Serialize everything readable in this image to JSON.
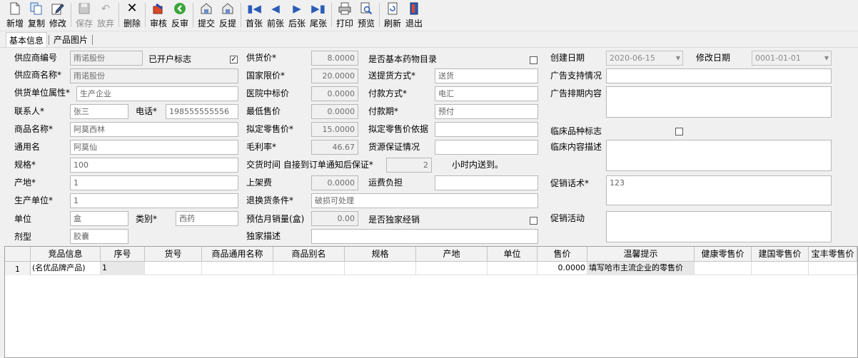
{
  "toolbar": [
    {
      "name": "new",
      "label": "新增",
      "enabled": true
    },
    {
      "name": "copy",
      "label": "复制",
      "enabled": true
    },
    {
      "name": "edit",
      "label": "修改",
      "enabled": true
    },
    {
      "name": "save",
      "label": "保存",
      "enabled": false
    },
    {
      "name": "discard",
      "label": "放弃",
      "enabled": false
    },
    {
      "name": "delete",
      "label": "删除",
      "enabled": true
    },
    {
      "name": "audit",
      "label": "审核",
      "enabled": true
    },
    {
      "name": "unaudit",
      "label": "反审",
      "enabled": true
    },
    {
      "name": "submit",
      "label": "提交",
      "enabled": true
    },
    {
      "name": "unsubmit",
      "label": "反提",
      "enabled": true
    },
    {
      "name": "first",
      "label": "首张",
      "enabled": true
    },
    {
      "name": "prev",
      "label": "前张",
      "enabled": true
    },
    {
      "name": "next",
      "label": "后张",
      "enabled": true
    },
    {
      "name": "last",
      "label": "尾张",
      "enabled": true
    },
    {
      "name": "print",
      "label": "打印",
      "enabled": true
    },
    {
      "name": "preview",
      "label": "预览",
      "enabled": true
    },
    {
      "name": "refresh",
      "label": "刷新",
      "enabled": true
    },
    {
      "name": "exit",
      "label": "退出",
      "enabled": true
    }
  ],
  "tabs": [
    "基本信息",
    "产品图片"
  ],
  "form": {
    "supplier_code_label": "供应商编号",
    "supplier_code": "雨诺股份",
    "account_opened_label": "已开户标志",
    "account_opened_check": "✓",
    "supplier_name_label": "供应商名称*",
    "supplier_name": "雨诺股份",
    "supplier_attr_label": "供货单位属性*",
    "supplier_attr": "生产企业",
    "contact_label": "联系人*",
    "contact": "张三",
    "phone_label": "电话*",
    "phone": "198555555556",
    "product_name_label": "商品名称*",
    "product_name": "阿莫西林",
    "generic_name_label": "通用名",
    "generic_name": "阿莫仙",
    "spec_label": "规格*",
    "spec": "100",
    "origin_label": "产地*",
    "origin": "1",
    "manufacturer_label": "生产单位*",
    "manufacturer": "1",
    "unit_label": "单位",
    "unit": "盒",
    "category_label": "类别*",
    "category": "西药",
    "dosage_label": "剂型",
    "dosage": "胶囊",
    "supply_price_label": "供货价*",
    "supply_price": "8.0000",
    "national_limit_label": "国家限价*",
    "national_limit": "20.0000",
    "hospital_bid_label": "医院中标价",
    "hospital_bid": "0.0000",
    "min_price_label": "最低售价",
    "min_price": "0.0000",
    "planned_retail_label": "拟定零售价*",
    "planned_retail": "15.0000",
    "margin_label": "毛利率*",
    "margin": "46.67",
    "delivery_time_label": "交货时间 自接到订单通知后保证*",
    "delivery_time": "2",
    "delivery_unit": "小时内送到。",
    "listing_fee_label": "上架费",
    "listing_fee": "0.0000",
    "return_cond_label": "退换货条件*",
    "return_cond": "破损可处理",
    "monthly_sales_label": "预估月销量(盒)",
    "monthly_sales": "0.00",
    "exclusive_desc_label": "独家描述",
    "exclusive_desc": "",
    "basic_drug_label": "是否基本药物目录",
    "delivery_method_label": "送提货方式*",
    "delivery_method": "送货",
    "payment_method_label": "付款方式*",
    "payment_method": "电汇",
    "payment_term_label": "付款期*",
    "payment_term": "预付",
    "retail_basis_label": "拟定零售价依据",
    "retail_basis": "",
    "supply_guarantee_label": "货源保证情况",
    "supply_guarantee": "",
    "freight_label": "运费负担",
    "freight": "",
    "exclusive_label": "是否独家经销",
    "created_date_label": "创建日期",
    "created_date": "2020-06-15",
    "modified_date_label": "修改日期",
    "modified_date": "0001-01-01",
    "ad_support_label": "广告支持情况",
    "ad_support": "",
    "ad_schedule_label": "广告排期内容",
    "ad_schedule": "",
    "clinical_flag_label": "临床品种标志",
    "clinical_desc_label": "临床内容描述",
    "clinical_desc": "",
    "promo_script_label": "促销话术*",
    "promo_script": "123",
    "promo_activity_label": "促销活动",
    "promo_activity": ""
  },
  "grid": {
    "columns": [
      "竞品信息",
      "序号",
      "货号",
      "商品通用名称",
      "商品别名",
      "规格",
      "产地",
      "单位",
      "售价",
      "温馨提示",
      "健康零售价",
      "建国零售价",
      "宝丰零售价"
    ],
    "rows": [
      {
        "row_no": "1",
        "cells": [
          "(名优品牌产品)",
          "1",
          "",
          "",
          "",
          "",
          "",
          "",
          "0.0000",
          "填写哈市主流企业的零售价",
          "",
          "",
          ""
        ]
      }
    ]
  }
}
